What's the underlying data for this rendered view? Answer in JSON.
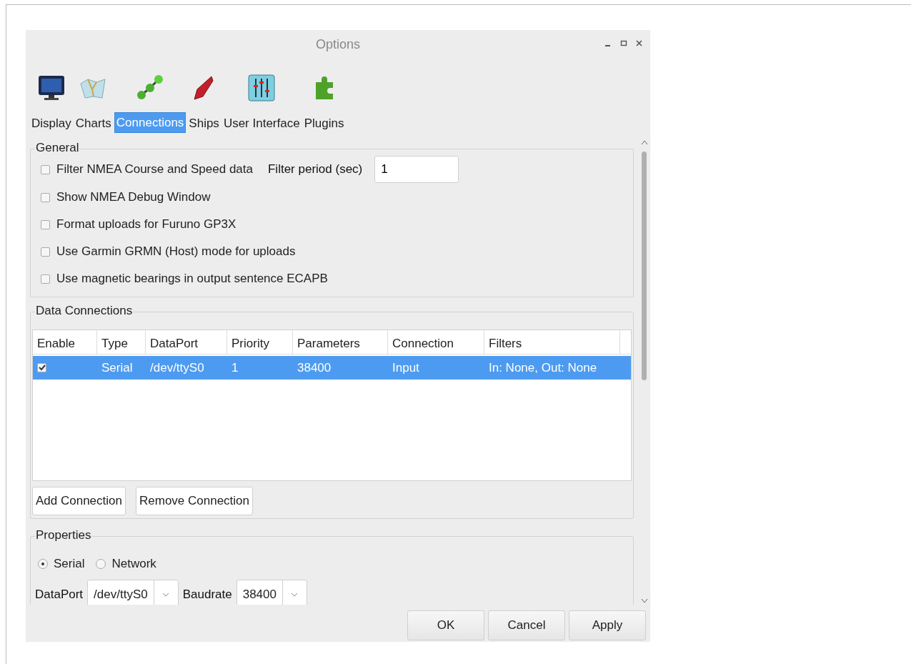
{
  "window": {
    "title": "Options"
  },
  "tabs": [
    {
      "label": "Display",
      "selected": false
    },
    {
      "label": "Charts",
      "selected": false
    },
    {
      "label": "Connections",
      "selected": true
    },
    {
      "label": "Ships",
      "selected": false
    },
    {
      "label": "User Interface",
      "selected": false
    },
    {
      "label": "Plugins",
      "selected": false
    }
  ],
  "general": {
    "title": "General",
    "options": [
      {
        "label": "Filter NMEA Course and Speed data",
        "checked": false
      },
      {
        "label": "Show NMEA Debug Window",
        "checked": false
      },
      {
        "label": "Format uploads for Furuno GP3X",
        "checked": false
      },
      {
        "label": "Use Garmin GRMN (Host) mode for uploads",
        "checked": false
      },
      {
        "label": "Use magnetic bearings in output sentence ECAPB",
        "checked": false
      }
    ],
    "filter_period": {
      "label": "Filter period (sec)",
      "value": "1"
    }
  },
  "data_connections": {
    "title": "Data Connections",
    "table": {
      "columns": [
        "Enable",
        "Type",
        "DataPort",
        "Priority",
        "Parameters",
        "Connection",
        "Filters"
      ],
      "rows": [
        {
          "enabled": true,
          "selected": true,
          "cells": [
            "",
            "Serial",
            "/dev/ttyS0",
            "1",
            "38400",
            "Input",
            "In: None, Out: None"
          ]
        }
      ]
    },
    "buttons": [
      "Add Connection",
      "Remove Connection"
    ]
  },
  "properties": {
    "title": "Properties",
    "radios": [
      {
        "label": "Serial",
        "selected": true
      },
      {
        "label": "Network",
        "selected": false
      }
    ],
    "dataport": {
      "label": "DataPort",
      "value": "/dev/ttyS0"
    },
    "baudrate": {
      "label": "Baudrate",
      "value": "38400"
    }
  },
  "buttons": [
    "OK",
    "Cancel",
    "Apply"
  ]
}
